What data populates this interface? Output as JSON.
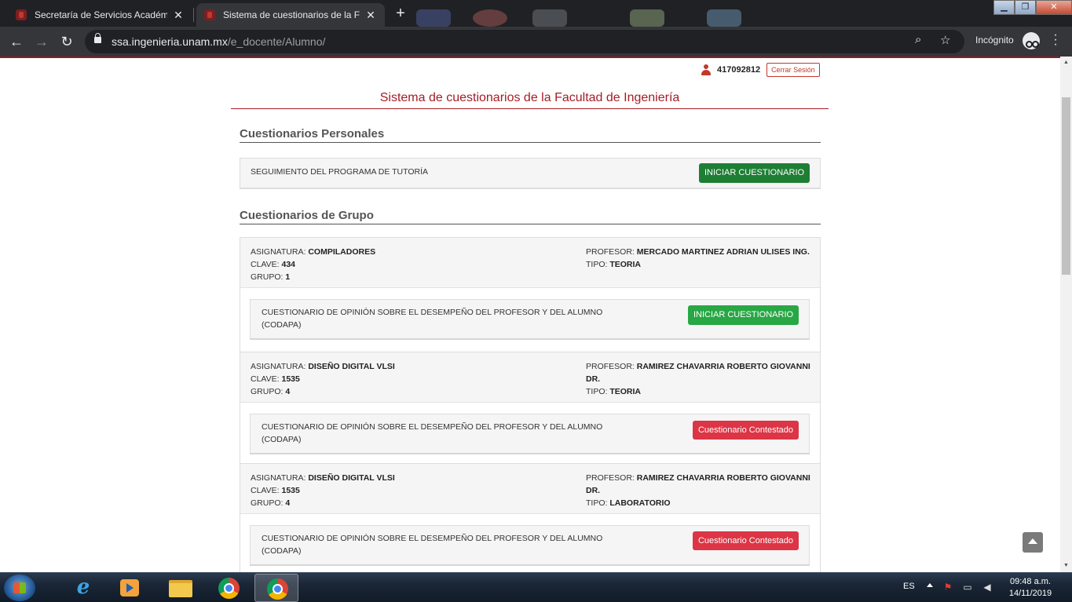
{
  "browser": {
    "tabs": [
      {
        "title": "Secretaría de Servicios Académicos",
        "close": "✕"
      },
      {
        "title": "Sistema de cuestionarios de la Facultad",
        "close": "✕"
      }
    ],
    "new_tab": "+",
    "url_host": "ssa.ingenieria.unam.mx",
    "url_path": "/e_docente/Alumno/",
    "incognito_label": "Incógnito"
  },
  "page": {
    "user_id": "417092812",
    "logout_label": "Cerrar Sesión",
    "site_title": "Sistema de cuestionarios de la Facultad de Ingeniería",
    "personal": {
      "heading": "Cuestionarios Personales",
      "questionnaire": "SEGUIMIENTO DEL PROGRAMA DE TUTORÍA",
      "button": "INICIAR CUESTIONARIO"
    },
    "groups_heading": "Cuestionarios de Grupo",
    "labels": {
      "asignatura": "ASIGNATURA:",
      "clave": "CLAVE:",
      "grupo": "GRUPO:",
      "profesor": "PROFESOR:",
      "tipo": "TIPO:"
    },
    "groups": [
      {
        "asignatura": "COMPILADORES",
        "clave": "434",
        "grupo": "1",
        "profesor": "MERCADO MARTINEZ ADRIAN ULISES ING.",
        "tipo": "TEORIA",
        "questionnaire": "CUESTIONARIO DE OPINIÓN SOBRE EL DESEMPEÑO DEL PROFESOR Y DEL ALUMNO (CODAPA)",
        "button": "INICIAR CUESTIONARIO",
        "status": "open"
      },
      {
        "asignatura": "DISEÑO DIGITAL VLSI",
        "clave": "1535",
        "grupo": "4",
        "profesor": "RAMIREZ CHAVARRIA ROBERTO GIOVANNI DR.",
        "tipo": "TEORIA",
        "questionnaire": "CUESTIONARIO DE OPINIÓN SOBRE EL DESEMPEÑO DEL PROFESOR Y DEL ALUMNO (CODAPA)",
        "button": "Cuestionario Contestado",
        "status": "answered"
      },
      {
        "asignatura": "DISEÑO DIGITAL VLSI",
        "clave": "1535",
        "grupo": "4",
        "profesor": "RAMIREZ CHAVARRIA ROBERTO GIOVANNI DR.",
        "tipo": "LABORATORIO",
        "questionnaire": "CUESTIONARIO DE OPINIÓN SOBRE EL DESEMPEÑO DEL PROFESOR Y DEL ALUMNO (CODAPA)",
        "button": "Cuestionario Contestado",
        "status": "answered"
      }
    ],
    "colors": {
      "brand_red": "#a61c25",
      "start_green": "#28a745",
      "answered_red": "#dc3545"
    }
  },
  "taskbar": {
    "language": "ES",
    "time": "09:48 a.m.",
    "date": "14/11/2019"
  }
}
